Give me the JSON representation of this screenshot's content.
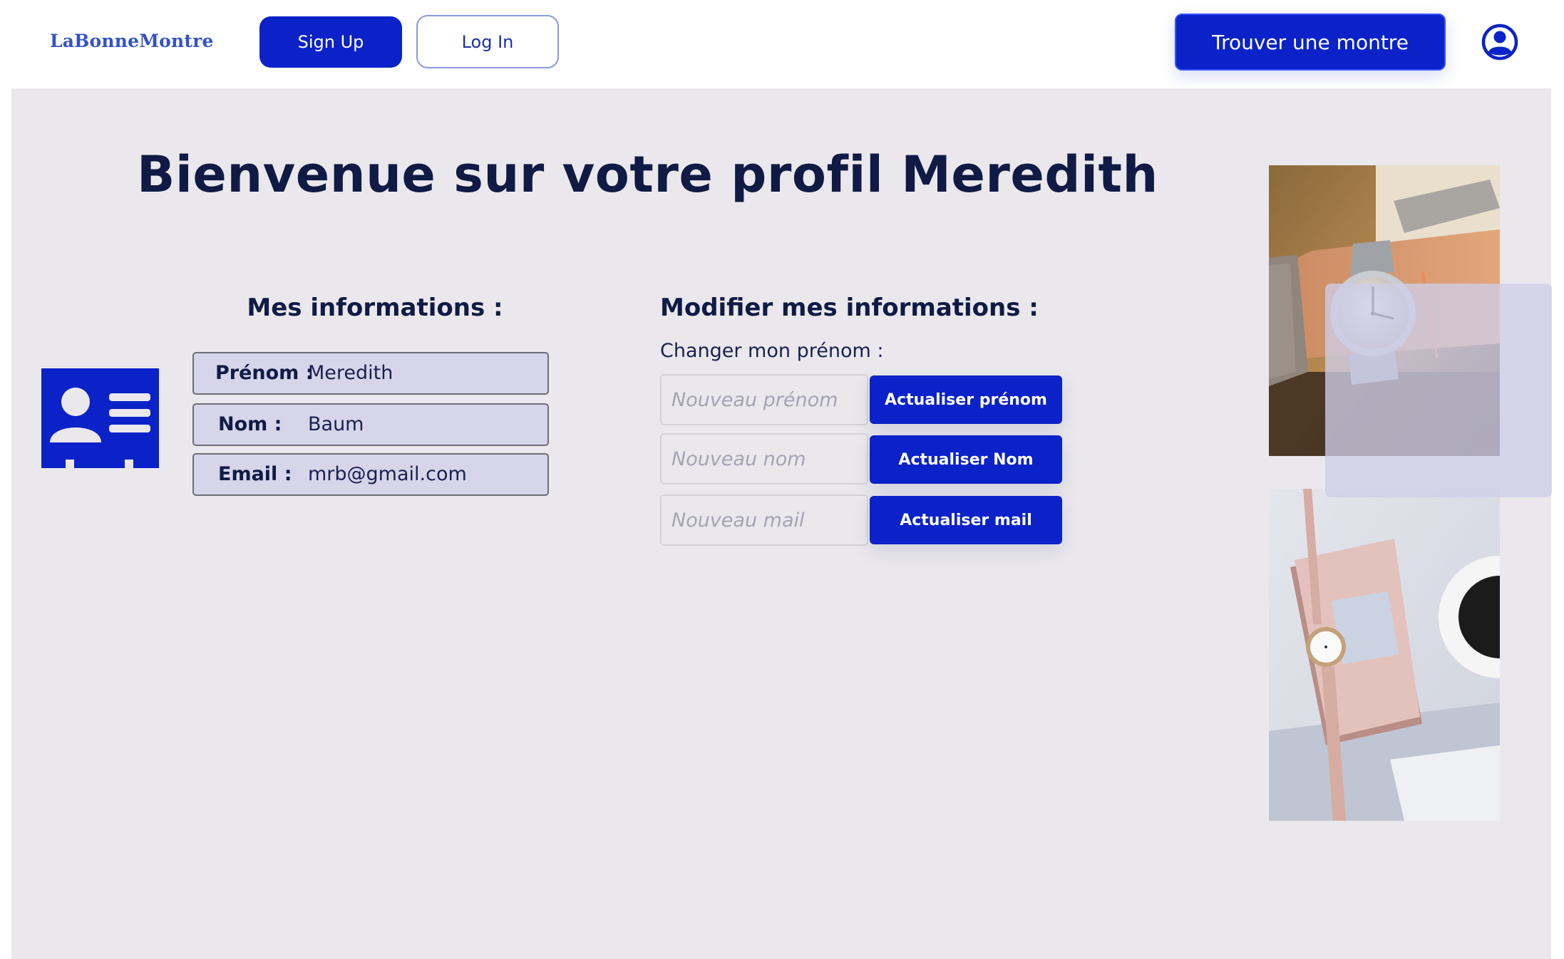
{
  "header": {
    "logo": "LaBonneMontre",
    "signup_label": "Sign Up",
    "login_label": "Log In",
    "find_watch_label": "Trouver une montre",
    "account_icon": "user-circle-icon"
  },
  "profile": {
    "title": "Bienvenue sur votre profil Meredith",
    "card_icon": "id-card-icon",
    "info_heading": "Mes informations :",
    "fields": [
      {
        "label": "Prénom :",
        "value": "Meredith"
      },
      {
        "label": "Nom :",
        "value": "Baum"
      },
      {
        "label": "Email :",
        "value": "mrb@gmail.com"
      }
    ]
  },
  "edit": {
    "heading": "Modifier mes informations :",
    "subtitle": "Changer mon prénom :",
    "rows": [
      {
        "placeholder": "Nouveau prénom",
        "button": "Actualiser prénom"
      },
      {
        "placeholder": "Nouveau nom",
        "button": "Actualiser Nom"
      },
      {
        "placeholder": "Nouveau mail",
        "button": "Actualiser mail"
      }
    ]
  },
  "colors": {
    "accent": "#0a22c8",
    "logo": "#3552c7",
    "panel_bg": "#eae8ec",
    "field_bg": "#d6d5ea",
    "text_dark": "#0f1b45"
  }
}
